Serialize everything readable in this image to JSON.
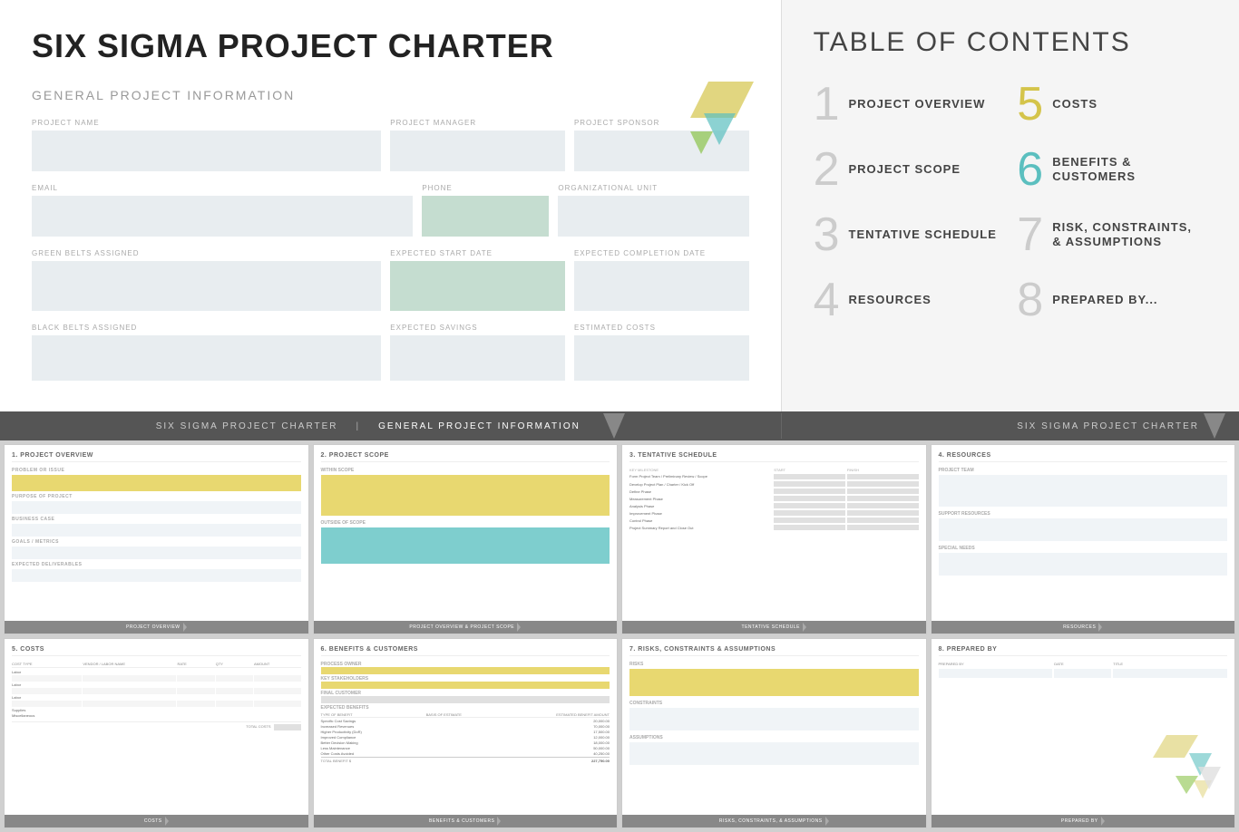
{
  "charter": {
    "title": "SIX SIGMA PROJECT CHARTER",
    "section_heading": "GENERAL PROJECT INFORMATION",
    "fields": {
      "project_name_label": "PROJECT NAME",
      "project_manager_label": "PROJECT MANAGER",
      "project_sponsor_label": "PROJECT SPONSOR",
      "email_label": "EMAIL",
      "phone_label": "PHONE",
      "org_unit_label": "ORGANIZATIONAL UNIT",
      "green_belts_label": "GREEN BELTS ASSIGNED",
      "expected_start_label": "EXPECTED START DATE",
      "expected_completion_label": "EXPECTED COMPLETION DATE",
      "black_belts_label": "BLACK BELTS ASSIGNED",
      "expected_savings_label": "EXPECTED SAVINGS",
      "estimated_costs_label": "ESTIMATED COSTS"
    }
  },
  "toc": {
    "title": "TABLE OF CONTENTS",
    "items": [
      {
        "number": "1",
        "label": "PROJECT OVERVIEW",
        "color": "default"
      },
      {
        "number": "5",
        "label": "COSTS",
        "color": "yellow"
      },
      {
        "number": "2",
        "label": "PROJECT SCOPE",
        "color": "default"
      },
      {
        "number": "6",
        "label": "BENEFITS & CUSTOMERS",
        "color": "teal"
      },
      {
        "number": "3",
        "label": "TENTATIVE SCHEDULE",
        "color": "default"
      },
      {
        "number": "7",
        "label": "RISK, CONSTRAINTS, & ASSUMPTIONS",
        "color": "default"
      },
      {
        "number": "4",
        "label": "RESOURCES",
        "color": "default"
      },
      {
        "number": "8",
        "label": "PREPARED BY...",
        "color": "default"
      }
    ]
  },
  "banner": {
    "left_text1": "SIX SIGMA PROJECT CHARTER",
    "divider": "|",
    "left_text2": "GENERAL PROJECT INFORMATION",
    "right_text": "SIX SIGMA PROJECT CHARTER"
  },
  "thumbnails": [
    {
      "id": "project-overview",
      "number": "1.",
      "title": "1. PROJECT OVERVIEW",
      "footer": "PROJECT OVERVIEW",
      "sections": [
        "PROBLEM OR ISSUE",
        "PURPOSE OF PROJECT",
        "BUSINESS CASE",
        "GOALS / METRICS",
        "EXPECTED DELIVERABLES"
      ]
    },
    {
      "id": "project-scope",
      "number": "2.",
      "title": "2. PROJECT SCOPE",
      "footer": "PROJECT OVERVIEW & PROJECT SCOPE",
      "sections": [
        "WITHIN SCOPE",
        "OUTSIDE OF SCOPE"
      ]
    },
    {
      "id": "tentative-schedule",
      "number": "3.",
      "title": "3. TENTATIVE SCHEDULE",
      "footer": "TENTATIVE SCHEDULE",
      "schedule_items": [
        "Form Project Team / Preliminary Review / Scope",
        "Develop Project Plan / Charter / Kick Off",
        "Define Phase",
        "Measurement Phase",
        "Analysis Phase",
        "Improvement Phase",
        "Control Phase",
        "Project Summary Report and Close Out"
      ]
    },
    {
      "id": "resources",
      "number": "4.",
      "title": "4. RESOURCES",
      "footer": "RESOURCES",
      "sections": [
        "PROJECT TEAM",
        "SUPPORT RESOURCES",
        "SPECIAL NEEDS"
      ]
    },
    {
      "id": "costs",
      "number": "5.",
      "title": "5. COSTS",
      "footer": "COSTS",
      "columns": [
        "COST TYPE",
        "VENDOR / LABOR NAME",
        "RATE",
        "QTY",
        "AMOUNT"
      ],
      "rows": [
        "Labor",
        "Labor",
        "Labor",
        "Supplies",
        "Miscellaneous"
      ],
      "total_label": "TOTAL COSTS"
    },
    {
      "id": "benefits-customers",
      "number": "6.",
      "title": "6. BENEFITS & CUSTOMERS",
      "footer": "BENEFITS & CUSTOMERS",
      "sections": [
        "PROCESS OWNER",
        "KEY STAKEHOLDERS",
        "FINAL CUSTOMER",
        "EXPECTED BENEFITS"
      ],
      "benefit_cols": [
        "TYPE OF BENEFIT",
        "BASIS OF ESTIMATE",
        "ESTIMATED BENEFIT AMOUNT"
      ],
      "benefits": [
        {
          "type": "Specific Cost Savings",
          "amount": "20,000.00"
        },
        {
          "type": "Increased Revenues",
          "amount": "70,000.00"
        },
        {
          "type": "Higher Productivity (DoR)",
          "amount": "17,500.00"
        },
        {
          "type": "Improved Compliance",
          "amount": "12,000.00"
        },
        {
          "type": "Better Decision Making",
          "amount": "18,000.00"
        },
        {
          "type": "Less Maintenance",
          "amount": "50,000.00"
        },
        {
          "type": "Other Costs Avoided",
          "amount": "40,250.00"
        }
      ],
      "total_label": "TOTAL BENEFIT",
      "total_amount": "227,750.00"
    },
    {
      "id": "risks",
      "number": "7.",
      "title": "7. RISKS, CONSTRAINTS & ASSUMPTIONS",
      "footer": "RISKS, CONSTRAINTS, & ASSUMPTIONS",
      "sections": [
        "RISKS",
        "CONSTRAINTS",
        "ASSUMPTIONS"
      ]
    },
    {
      "id": "prepared-by",
      "number": "8.",
      "title": "8. PREPARED BY",
      "footer": "PREPARED BY",
      "columns": [
        "PREPARED BY",
        "DATE",
        "TITLE"
      ]
    }
  ]
}
